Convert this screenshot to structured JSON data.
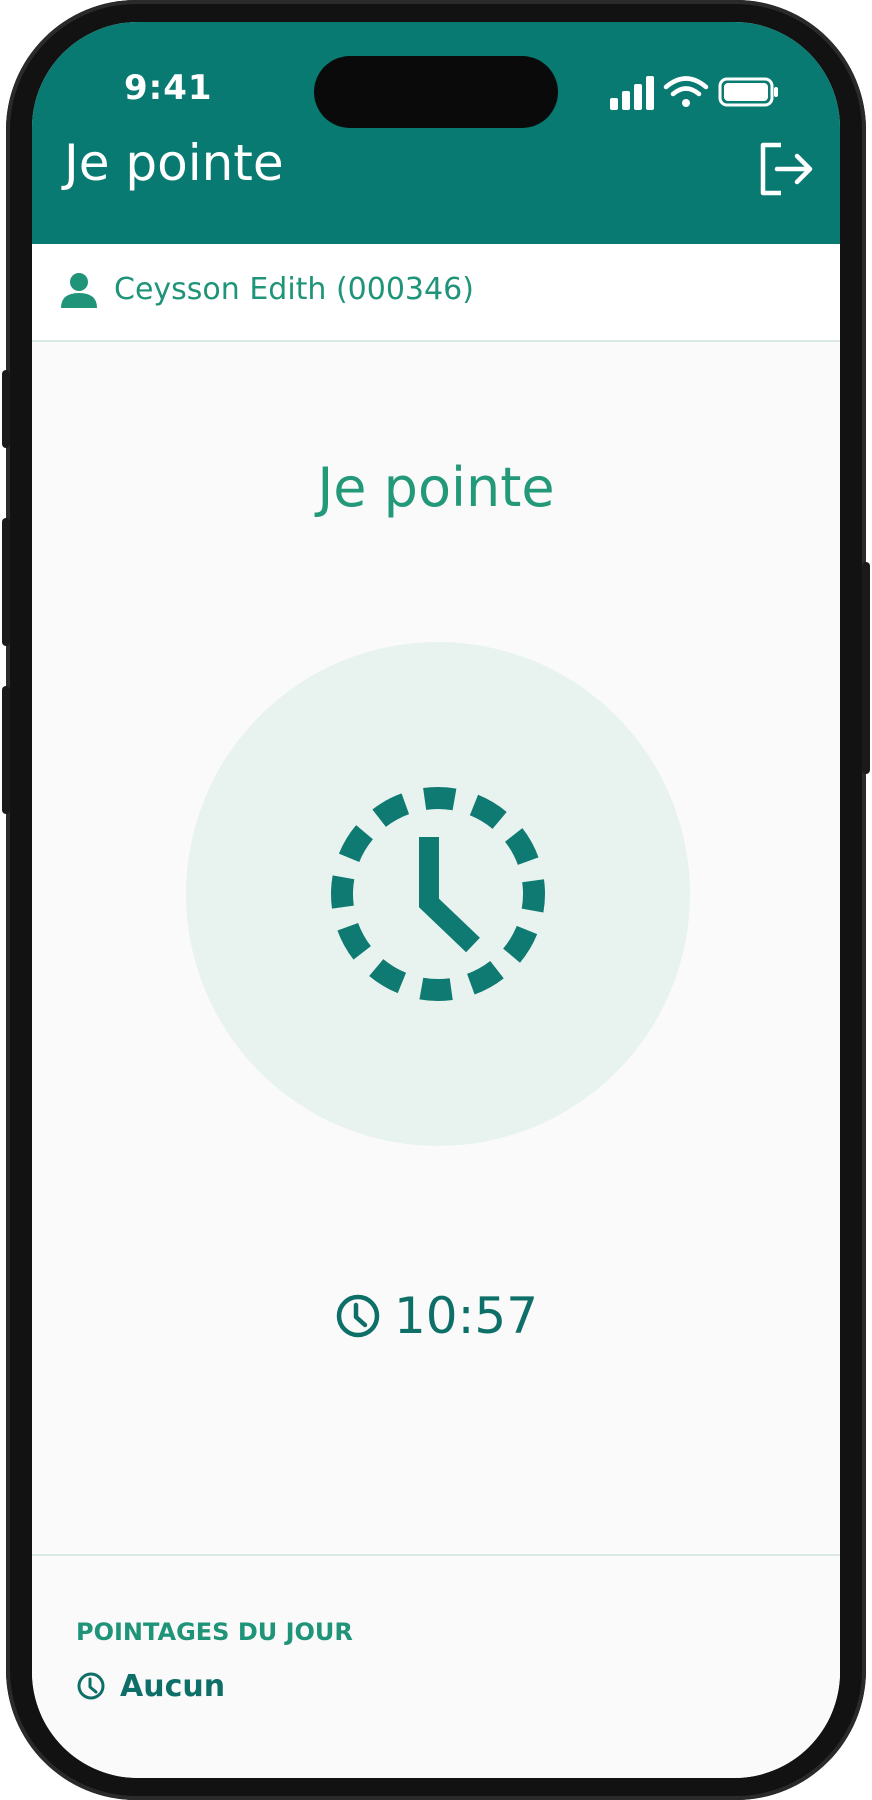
{
  "status_bar": {
    "time": "9:41"
  },
  "app_bar": {
    "title": "Je pointe",
    "logout_icon": "logout-icon"
  },
  "user": {
    "name": "Ceysson Edith (000346)",
    "icon": "person-icon"
  },
  "main": {
    "title": "Je pointe",
    "clock_icon": "dashed-clock-icon",
    "current_time": "10:57"
  },
  "daily_entries": {
    "title": "POINTAGES DU JOUR",
    "value": "Aucun"
  },
  "colors": {
    "primary": "#087a72",
    "accent_green": "#23997a",
    "dark_teal": "#0e6f68",
    "circle_bg": "#e8f3f0",
    "background": "#fafafa"
  }
}
